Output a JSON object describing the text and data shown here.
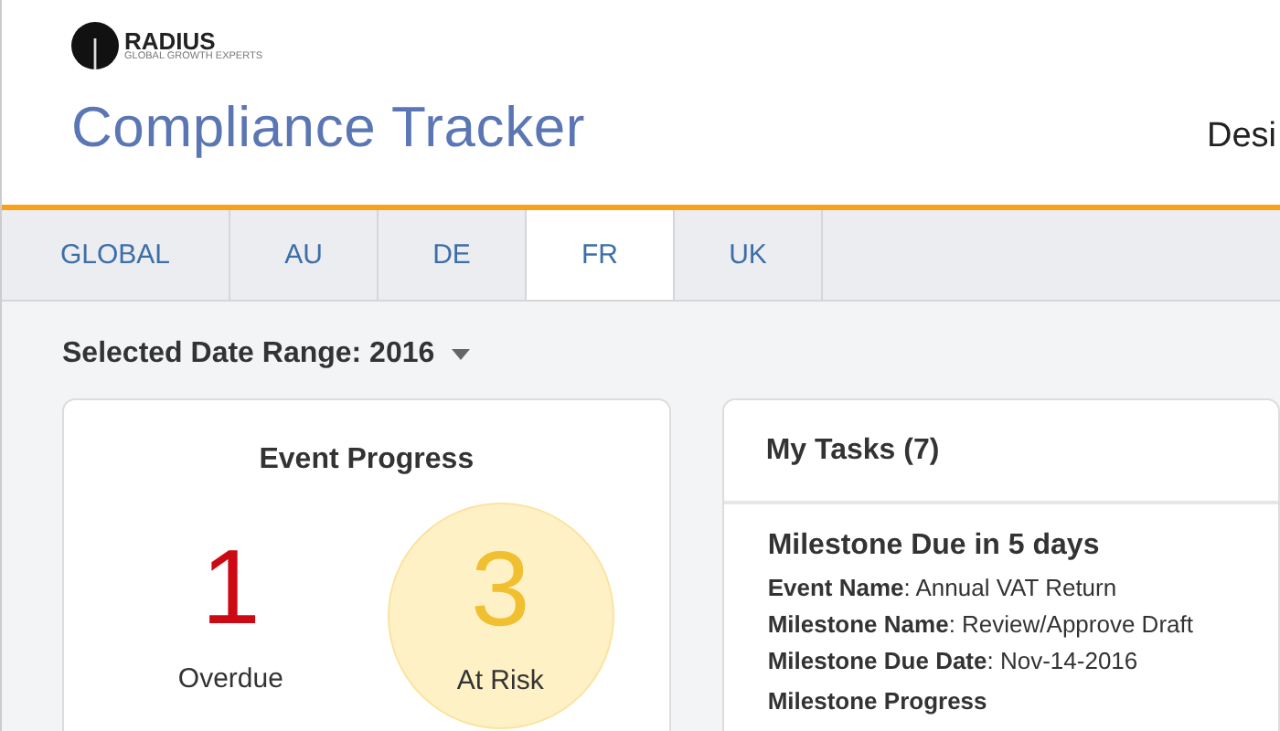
{
  "brand": {
    "name": "RADIUS",
    "tagline": "GLOBAL GROWTH EXPERTS"
  },
  "app_title": "Compliance Tracker",
  "header_right": "Desi",
  "tabs": [
    {
      "label": "GLOBAL",
      "selected": false
    },
    {
      "label": "AU",
      "selected": false
    },
    {
      "label": "DE",
      "selected": false
    },
    {
      "label": "FR",
      "selected": true
    },
    {
      "label": "UK",
      "selected": false
    }
  ],
  "date_range": "Selected Date Range: 2016",
  "event_progress": {
    "title": "Event Progress",
    "stats": [
      {
        "value": "1",
        "label": "Overdue",
        "color": "#cc0a14",
        "highlighted": false
      },
      {
        "value": "3",
        "label": "At Risk",
        "color": "#f0c030",
        "highlighted": true
      }
    ]
  },
  "my_tasks": {
    "title": "My Tasks (7)",
    "task": {
      "heading": "Milestone Due in 5 days",
      "details": [
        "**Event Name**: Annual VAT Return",
        "**Milestone Name**: Review/Approve Draft",
        "**Milestone Due Date**: Nov-14-2016"
      ],
      "progress_label": "Milestone Progress"
    }
  }
}
